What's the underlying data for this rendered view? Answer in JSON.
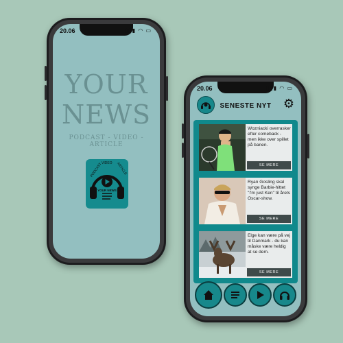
{
  "colors": {
    "background": "#a8c8b8",
    "screen": "#93bfc0",
    "accent": "#10898c",
    "wordmark": "#6a9192"
  },
  "splash": {
    "status_time": "20.06",
    "title_line1": "YOUR",
    "title_line2": "NEWS",
    "tagline": "PODCAST - VIDEO - ARTICLE",
    "logo": {
      "arc_text_1": "PODCAST",
      "arc_text_2": "VIDEO",
      "arc_text_3": "ARTICLE",
      "label": "YOUR NEWS"
    }
  },
  "feed": {
    "status_time": "20.06",
    "header_title": "SENESTE NYT",
    "articles": [
      {
        "text": "Wozniacki overrasker efter comeback - men ikke over spillet på banen.",
        "button": "SE MERE",
        "image": "tennis-player-photo"
      },
      {
        "text": "Ryan Gosling skal synge Barbie-hittet \"I'm just Ken\" til årets Oscar-show.",
        "button": "SE MERE",
        "image": "ryan-gosling-photo"
      },
      {
        "text": "Elge kan være på vej til Danmark - du kan måske være heldig at se dem.",
        "button": "SE MERE",
        "image": "moose-photo"
      }
    ],
    "tabs": [
      "home-icon",
      "article-icon",
      "play-icon",
      "headphones-icon"
    ]
  }
}
